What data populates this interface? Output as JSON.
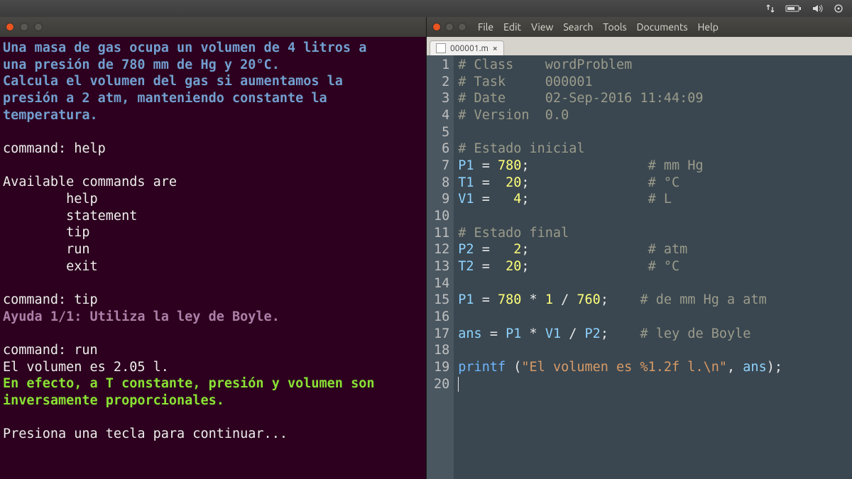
{
  "top_panel": {
    "net_icon": "↑↓",
    "battery_icon": "🔋",
    "sound_icon": "🔊",
    "gear_icon": "⏻"
  },
  "terminal": {
    "problem_line1": "Una masa de gas ocupa un volumen de 4 litros a",
    "problem_line2": "una presión de 780 mm de Hg y 20°C.",
    "problem_line3": "Calcula el volumen del gas si aumentamos la",
    "problem_line4": "presión a 2 atm, manteniendo constante la",
    "problem_line5": "temperatura.",
    "prompt1": "command: help",
    "avail": "Available commands are",
    "cmd_help": "        help",
    "cmd_statement": "        statement",
    "cmd_tip": "        tip",
    "cmd_run": "        run",
    "cmd_exit": "        exit",
    "prompt2": "command: tip",
    "tip_line": "Ayuda 1/1: Utiliza la ley de Boyle.",
    "prompt3": "command: run",
    "run_result": "El volumen es 2.05 l.",
    "run_expl1": "En efecto, a T constante, presión y volumen son",
    "run_expl2": "inversamente proporcionales.",
    "continue": "Presiona una tecla para continuar..."
  },
  "editor": {
    "menus": [
      "File",
      "Edit",
      "View",
      "Search",
      "Tools",
      "Documents",
      "Help"
    ],
    "tab_name": "000001.m",
    "lines": {
      "l1": {
        "comment": "# Class    wordProblem"
      },
      "l2": {
        "comment": "# Task     000001"
      },
      "l3": {
        "comment": "# Date     02-Sep-2016 11:44:09"
      },
      "l4": {
        "comment": "# Version  0.0"
      },
      "l6": {
        "comment": "# Estado inicial"
      },
      "l7": {
        "ident": "P1",
        "op": " = ",
        "num": "780",
        "tail": ";",
        "pad": "               ",
        "comment": "# mm Hg"
      },
      "l8": {
        "ident": "T1",
        "op": " =  ",
        "num": "20",
        "tail": ";",
        "pad": "               ",
        "comment": "# °C"
      },
      "l9": {
        "ident": "V1",
        "op": " =   ",
        "num": "4",
        "tail": ";",
        "pad": "               ",
        "comment": "# L"
      },
      "l11": {
        "comment": "# Estado final"
      },
      "l12": {
        "ident": "P2",
        "op": " =   ",
        "num": "2",
        "tail": ";",
        "pad": "               ",
        "comment": "# atm"
      },
      "l13": {
        "ident": "T2",
        "op": " =  ",
        "num": "20",
        "tail": ";",
        "pad": "               ",
        "comment": "# °C"
      },
      "l15": {
        "ident": "P1",
        "op": " = ",
        "num1": "780",
        "op2": " * ",
        "num2": "1",
        "op3": " / ",
        "num3": "760",
        "tail": ";",
        "pad": "    ",
        "comment": "# de mm Hg a atm"
      },
      "l17": {
        "ident": "ans",
        "op": " = ",
        "ident2": "P1",
        "op2": " * ",
        "ident3": "V1",
        "op3": " / ",
        "ident4": "P2",
        "tail": ";",
        "pad": "    ",
        "comment": "# ley de Boyle"
      },
      "l19": {
        "func": "printf",
        "open": " (",
        "str1": "\"El volumen es ",
        "fmt": "%1.2f",
        "str2": " l.",
        "esc": "\\n",
        "str3": "\"",
        "comma": ", ",
        "ident": "ans",
        "close": ");"
      }
    },
    "line_numbers": [
      " 1",
      " 2",
      " 3",
      " 4",
      " 5",
      " 6",
      " 7",
      " 8",
      " 9",
      "10",
      "11",
      "12",
      "13",
      "14",
      "15",
      "16",
      "17",
      "18",
      "19",
      "20"
    ]
  }
}
